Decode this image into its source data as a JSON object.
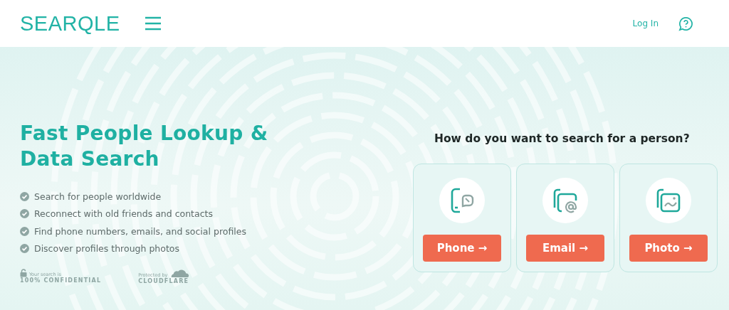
{
  "header": {
    "logo": "SEARQLE",
    "login": "Log In"
  },
  "hero": {
    "title": "Fast People Lookup & Data Search",
    "features": [
      "Search for people worldwide",
      "Reconnect with old friends and contacts",
      "Find phone numbers, emails, and social profiles",
      "Discover profiles through photos"
    ],
    "badges": [
      {
        "kind": "lock",
        "small": "Your search is",
        "big": "100% CONFIDENTIAL"
      },
      {
        "kind": "cloud",
        "small": "Protected by",
        "big": "CLOUDFLARE"
      }
    ]
  },
  "search": {
    "question": "How do you want to search for a person?",
    "options": [
      {
        "kind": "phone",
        "label": "Phone →"
      },
      {
        "kind": "email",
        "label": "Email →"
      },
      {
        "kind": "photo",
        "label": "Photo →"
      }
    ]
  }
}
